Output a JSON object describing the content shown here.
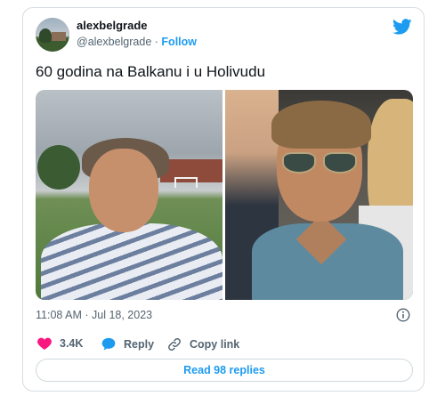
{
  "author": {
    "name": "alexbelgrade",
    "handle": "@alexbelgrade",
    "separator": "·",
    "follow_label": "Follow"
  },
  "tweet": {
    "text": "60 godina na Balkanu i u Holivudu",
    "timestamp": "11:08 AM · Jul 18, 2023"
  },
  "actions": {
    "like_count": "3.4K",
    "reply_label": "Reply",
    "copy_link_label": "Copy link"
  },
  "replies_button": {
    "label": "Read 98 replies"
  },
  "icons": {
    "brand": "twitter-bird-icon",
    "info": "info-icon",
    "like": "heart-icon",
    "reply": "speech-bubble-icon",
    "copy": "link-icon"
  },
  "colors": {
    "accent": "#1d9bf0",
    "like": "#f91880",
    "secondary_text": "#536471",
    "border": "#d6dde2"
  }
}
